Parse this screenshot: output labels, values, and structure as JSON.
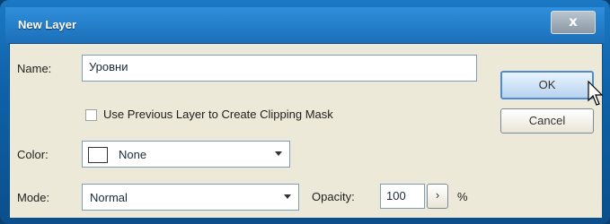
{
  "window": {
    "title": "New Layer",
    "close_label": "x"
  },
  "form": {
    "name_label": "Name:",
    "name_value": "Уровни",
    "clipping_mask_label": "Use Previous Layer to Create Clipping Mask",
    "clipping_mask_checked": false,
    "color_label": "Color:",
    "color_value": "None",
    "mode_label": "Mode:",
    "mode_value": "Normal",
    "opacity_label": "Opacity:",
    "opacity_value": "100",
    "opacity_unit": "%"
  },
  "buttons": {
    "ok_label": "OK",
    "cancel_label": "Cancel"
  },
  "icons": {
    "close": "close-icon",
    "dropdown": "chevron-down-icon",
    "stepper": "chevron-right-icon",
    "cursor": "mouse-pointer-icon"
  },
  "colors": {
    "window_frame": "#1b78c4",
    "panel_bg": "#ece9d8",
    "default_button_border": "#4d8ccf"
  }
}
